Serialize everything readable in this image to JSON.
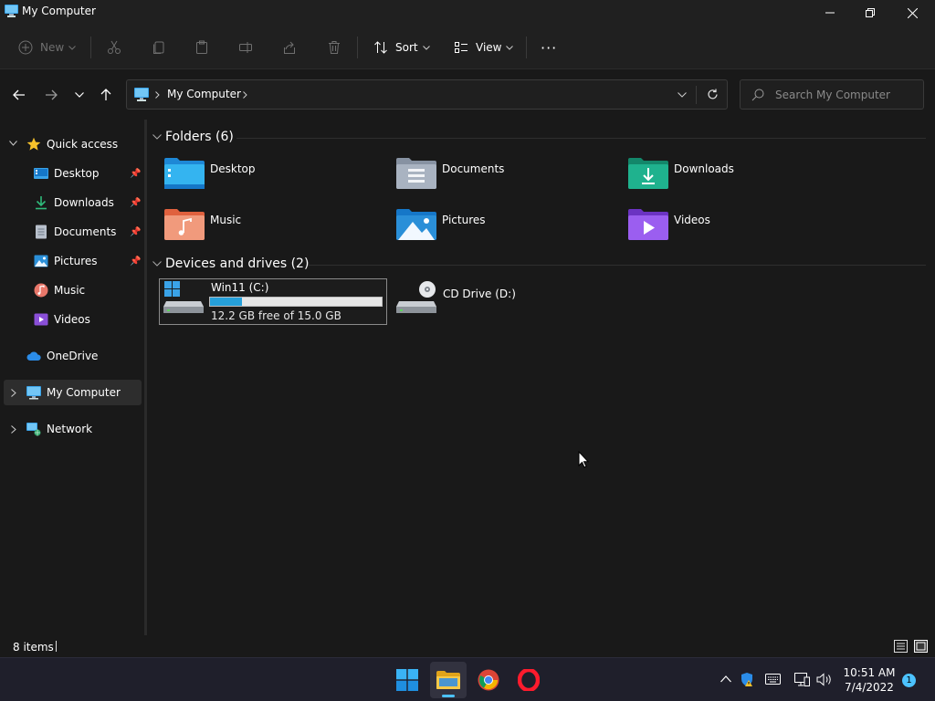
{
  "window": {
    "title": "My Computer"
  },
  "toolbar": {
    "new_label": "New",
    "sort_label": "Sort",
    "view_label": "View",
    "more_label": "···"
  },
  "address": {
    "crumb": "My Computer",
    "search_placeholder": "Search My Computer"
  },
  "sidebar": {
    "items": [
      {
        "label": "Quick access"
      },
      {
        "label": "Desktop"
      },
      {
        "label": "Downloads"
      },
      {
        "label": "Documents"
      },
      {
        "label": "Pictures"
      },
      {
        "label": "Music"
      },
      {
        "label": "Videos"
      },
      {
        "label": "OneDrive"
      },
      {
        "label": "My Computer"
      },
      {
        "label": "Network"
      }
    ]
  },
  "content": {
    "folders_header": "Folders (6)",
    "folders": [
      {
        "name": "Desktop"
      },
      {
        "name": "Documents"
      },
      {
        "name": "Downloads"
      },
      {
        "name": "Music"
      },
      {
        "name": "Pictures"
      },
      {
        "name": "Videos"
      }
    ],
    "drives_header": "Devices and drives (2)",
    "drives": [
      {
        "name": "Win11 (C:)",
        "free_text": "12.2 GB free of 15.0 GB",
        "used_fraction": 0.187
      },
      {
        "name": "CD Drive (D:)"
      }
    ]
  },
  "status": {
    "count": "8 items"
  },
  "taskbar": {
    "time": "10:51 AM",
    "date": "7/4/2022",
    "notifications": "1"
  },
  "colors": {
    "accent": "#26a0da",
    "background": "#191919",
    "chrome": "#202020"
  }
}
